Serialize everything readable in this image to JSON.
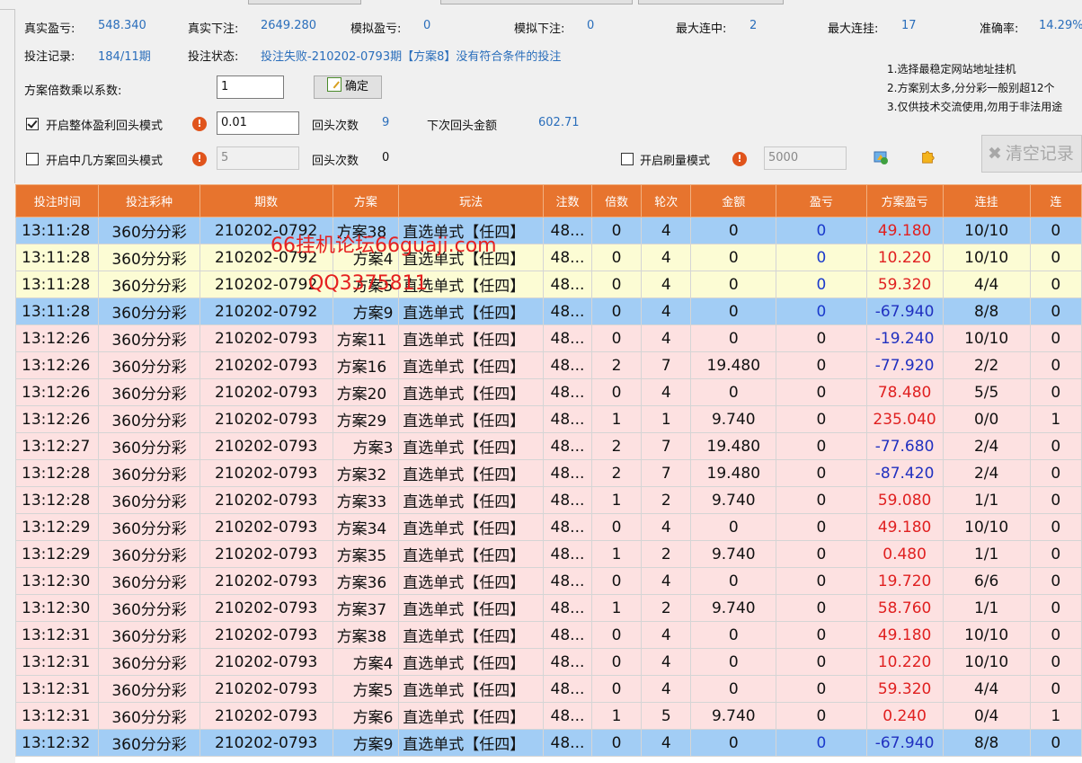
{
  "stats": {
    "real_profit_label": "真实盈亏:",
    "real_profit": "548.340",
    "real_bet_label": "真实下注:",
    "real_bet": "2649.280",
    "sim_profit_label": "模拟盈亏:",
    "sim_profit": "0",
    "sim_bet_label": "模拟下注:",
    "sim_bet": "0",
    "max_win_label": "最大连中:",
    "max_win": "2",
    "max_loss_label": "最大连挂:",
    "max_loss": "17",
    "accuracy_label": "准确率:",
    "accuracy": "14.29%",
    "record_label": "投注记录:",
    "record": "184/11期",
    "status_label": "投注状态:",
    "status": "投注失败-210202-0793期【方案8】没有符合条件的投注"
  },
  "controls": {
    "multiplier_label": "方案倍数乘以系数:",
    "multiplier_value": "1",
    "confirm_label": "确定",
    "overall_mode_label": "开启整体盈利回头模式",
    "overall_mode_checked": true,
    "overall_value": "0.01",
    "overall_count_label": "回头次数",
    "overall_count": "9",
    "next_amount_label": "下次回头金额",
    "next_amount": "602.71",
    "middle_mode_label": "开启中几方案回头模式",
    "middle_mode_checked": false,
    "middle_value": "5",
    "middle_count_label": "回头次数",
    "middle_count": "0",
    "brush_mode_label": "开启刷量模式",
    "brush_mode_checked": false,
    "brush_value": "5000",
    "clear_label": "清空记录"
  },
  "notes": [
    "1.选择最稳定网站地址挂机",
    "2.方案别太多,分分彩一般别超12个",
    "3.仅供技术交流使用,勿用于非法用途"
  ],
  "watermark": {
    "line1": "66挂机论坛66guaji.com",
    "line2": "QQ3375811"
  },
  "table": {
    "columns": [
      "投注时间",
      "投注彩种",
      "期数",
      "方案",
      "玩法",
      "注数",
      "倍数",
      "轮次",
      "金额",
      "盈亏",
      "方案盈亏",
      "连挂",
      "连"
    ],
    "rows": [
      {
        "style": "blue",
        "cells": [
          "13:11:28",
          "360分分彩",
          "210202-0792",
          "方案38",
          "直选单式【任四】",
          "48...",
          "0",
          "4",
          "0",
          "0",
          "49.180",
          "10/10",
          "0"
        ]
      },
      {
        "style": "yellow",
        "cells": [
          "13:11:28",
          "360分分彩",
          "210202-0792",
          "方案4",
          "直选单式【任四】",
          "48...",
          "0",
          "4",
          "0",
          "0",
          "10.220",
          "10/10",
          "0"
        ]
      },
      {
        "style": "yellow",
        "cells": [
          "13:11:28",
          "360分分彩",
          "210202-0792",
          "方案5",
          "直选单式【任四】",
          "48...",
          "0",
          "4",
          "0",
          "0",
          "59.320",
          "4/4",
          "0"
        ]
      },
      {
        "style": "blue",
        "cells": [
          "13:11:28",
          "360分分彩",
          "210202-0792",
          "方案9",
          "直选单式【任四】",
          "48...",
          "0",
          "4",
          "0",
          "0",
          "-67.940",
          "8/8",
          "0"
        ]
      },
      {
        "style": "pink",
        "cells": [
          "13:12:26",
          "360分分彩",
          "210202-0793",
          "方案11",
          "直选单式【任四】",
          "48...",
          "0",
          "4",
          "0",
          "0",
          "-19.240",
          "10/10",
          "0"
        ]
      },
      {
        "style": "pink",
        "cells": [
          "13:12:26",
          "360分分彩",
          "210202-0793",
          "方案16",
          "直选单式【任四】",
          "48...",
          "2",
          "7",
          "19.480",
          "0",
          "-77.920",
          "2/2",
          "0"
        ]
      },
      {
        "style": "pink",
        "cells": [
          "13:12:26",
          "360分分彩",
          "210202-0793",
          "方案20",
          "直选单式【任四】",
          "48...",
          "0",
          "4",
          "0",
          "0",
          "78.480",
          "5/5",
          "0"
        ]
      },
      {
        "style": "pink",
        "cells": [
          "13:12:26",
          "360分分彩",
          "210202-0793",
          "方案29",
          "直选单式【任四】",
          "48...",
          "1",
          "1",
          "9.740",
          "0",
          "235.040",
          "0/0",
          "1"
        ]
      },
      {
        "style": "pink",
        "cells": [
          "13:12:27",
          "360分分彩",
          "210202-0793",
          "方案3",
          "直选单式【任四】",
          "48...",
          "2",
          "7",
          "19.480",
          "0",
          "-77.680",
          "2/4",
          "0"
        ]
      },
      {
        "style": "pink",
        "cells": [
          "13:12:28",
          "360分分彩",
          "210202-0793",
          "方案32",
          "直选单式【任四】",
          "48...",
          "2",
          "7",
          "19.480",
          "0",
          "-87.420",
          "2/4",
          "0"
        ]
      },
      {
        "style": "pink",
        "cells": [
          "13:12:28",
          "360分分彩",
          "210202-0793",
          "方案33",
          "直选单式【任四】",
          "48...",
          "1",
          "2",
          "9.740",
          "0",
          "59.080",
          "1/1",
          "0"
        ]
      },
      {
        "style": "pink",
        "cells": [
          "13:12:29",
          "360分分彩",
          "210202-0793",
          "方案34",
          "直选单式【任四】",
          "48...",
          "0",
          "4",
          "0",
          "0",
          "49.180",
          "10/10",
          "0"
        ]
      },
      {
        "style": "pink",
        "cells": [
          "13:12:29",
          "360分分彩",
          "210202-0793",
          "方案35",
          "直选单式【任四】",
          "48...",
          "1",
          "2",
          "9.740",
          "0",
          "0.480",
          "1/1",
          "0"
        ]
      },
      {
        "style": "pink",
        "cells": [
          "13:12:30",
          "360分分彩",
          "210202-0793",
          "方案36",
          "直选单式【任四】",
          "48...",
          "0",
          "4",
          "0",
          "0",
          "19.720",
          "6/6",
          "0"
        ]
      },
      {
        "style": "pink",
        "cells": [
          "13:12:30",
          "360分分彩",
          "210202-0793",
          "方案37",
          "直选单式【任四】",
          "48...",
          "1",
          "2",
          "9.740",
          "0",
          "58.760",
          "1/1",
          "0"
        ]
      },
      {
        "style": "pink",
        "cells": [
          "13:12:31",
          "360分分彩",
          "210202-0793",
          "方案38",
          "直选单式【任四】",
          "48...",
          "0",
          "4",
          "0",
          "0",
          "49.180",
          "10/10",
          "0"
        ]
      },
      {
        "style": "pink",
        "cells": [
          "13:12:31",
          "360分分彩",
          "210202-0793",
          "方案4",
          "直选单式【任四】",
          "48...",
          "0",
          "4",
          "0",
          "0",
          "10.220",
          "10/10",
          "0"
        ]
      },
      {
        "style": "pink",
        "cells": [
          "13:12:31",
          "360分分彩",
          "210202-0793",
          "方案5",
          "直选单式【任四】",
          "48...",
          "0",
          "4",
          "0",
          "0",
          "59.320",
          "4/4",
          "0"
        ]
      },
      {
        "style": "pink",
        "cells": [
          "13:12:31",
          "360分分彩",
          "210202-0793",
          "方案6",
          "直选单式【任四】",
          "48...",
          "1",
          "5",
          "9.740",
          "0",
          "0.240",
          "0/4",
          "1"
        ]
      },
      {
        "style": "blue",
        "cells": [
          "13:12:32",
          "360分分彩",
          "210202-0793",
          "方案9",
          "直选单式【任四】",
          "48...",
          "0",
          "4",
          "0",
          "0",
          "-67.940",
          "8/8",
          "0"
        ]
      }
    ]
  }
}
